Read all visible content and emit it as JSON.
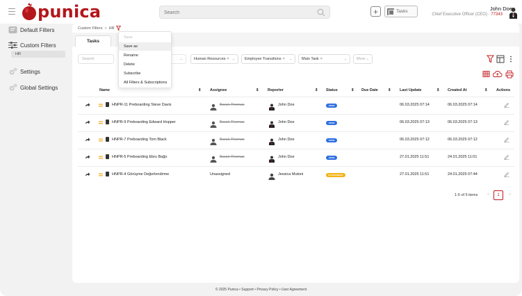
{
  "app": {
    "brand": "punica",
    "brand_color": "#b3171b",
    "accent_color": "#c0171b"
  },
  "header": {
    "search_placeholder": "Search",
    "tasks_label": "Tasks",
    "user_name": "John Doe",
    "user_role": "Chief Executive Officer (CEO) ·",
    "user_id": "77343"
  },
  "sidebar": {
    "items": [
      {
        "label": "Default Filters",
        "icon": "filter-list-icon"
      },
      {
        "label": "Custom Filters",
        "icon": "sliders-icon"
      },
      {
        "label": "Settings",
        "icon": "gears-icon"
      },
      {
        "label": "Global Settings",
        "icon": "gears-icon"
      }
    ],
    "sub_item": "HR"
  },
  "breadcrumb": {
    "root": "Custom Filters",
    "separator": ">",
    "current": "HR"
  },
  "tabs": [
    {
      "label": "Tasks"
    }
  ],
  "filters": {
    "search_placeholder": "Search",
    "chips": [
      {
        "label": "Human Resources"
      },
      {
        "label": "Employee Transitions"
      },
      {
        "label": "Main Task"
      }
    ],
    "more_label": "More"
  },
  "menu": {
    "items": [
      {
        "label": "Save",
        "state": "disabled"
      },
      {
        "label": "Save as",
        "state": "hover"
      },
      {
        "label": "Rename",
        "state": "normal"
      },
      {
        "label": "Delete",
        "state": "normal"
      },
      {
        "label": "Subscribe",
        "state": "normal"
      },
      {
        "label": "All Filters & Subscriptions",
        "state": "normal"
      }
    ]
  },
  "table": {
    "columns": [
      "Name",
      "Assignee",
      "Reporter",
      "Status",
      "Due Date",
      "Last Update",
      "Created At",
      "Actions"
    ],
    "rows": [
      {
        "name": "HNPR-11 Preboarding Steve Davis",
        "assignee": "Barak Thomas",
        "assignee_struck": true,
        "reporter": "John Doe",
        "status": "OPEN",
        "status_color": "#2f6fe0",
        "due_date": "",
        "last_update": "06.03.2025 07:14",
        "created_at": "06.03.2025 07:14"
      },
      {
        "name": "HNPR-9 Preboarding Edward Hopper",
        "assignee": "Barak Thomas",
        "assignee_struck": true,
        "reporter": "John Doe",
        "status": "OPEN",
        "status_color": "#2f6fe0",
        "due_date": "",
        "last_update": "06.03.2025 07:13",
        "created_at": "06.03.2025 07:13"
      },
      {
        "name": "HNPR-7 Preboarding Tom Black",
        "assignee": "Barak Thomas",
        "assignee_struck": true,
        "reporter": "John Doe",
        "status": "OPEN",
        "status_color": "#2f6fe0",
        "due_date": "",
        "last_update": "06.03.2025 07:12",
        "created_at": "06.03.2025 07:12"
      },
      {
        "name": "HNPR-5 Preboarding Ebru Bağo",
        "assignee": "Barak Thomas",
        "assignee_struck": true,
        "reporter": "John Doe",
        "status": "OPEN",
        "status_color": "#2f6fe0",
        "due_date": "",
        "last_update": "27.01.2025 11:51",
        "created_at": "24.01.2025 11:01"
      },
      {
        "name": "HNPR-4 Görüşme Değerlendirme",
        "assignee": "Unassigned",
        "assignee_struck": false,
        "reporter": "Jessica Mutoni",
        "status": "IN PROGRESS",
        "status_color": "#f2b316",
        "due_date": "",
        "last_update": "27.01.2025 11:51",
        "created_at": "24.01.2025 07:44"
      }
    ]
  },
  "pagination": {
    "summary": "1-5 of 5 items",
    "prev": "<",
    "current": "1",
    "next": ">"
  },
  "footer": {
    "text": "© 2025 Punica • Support • Privacy Policy • User Agreement"
  }
}
